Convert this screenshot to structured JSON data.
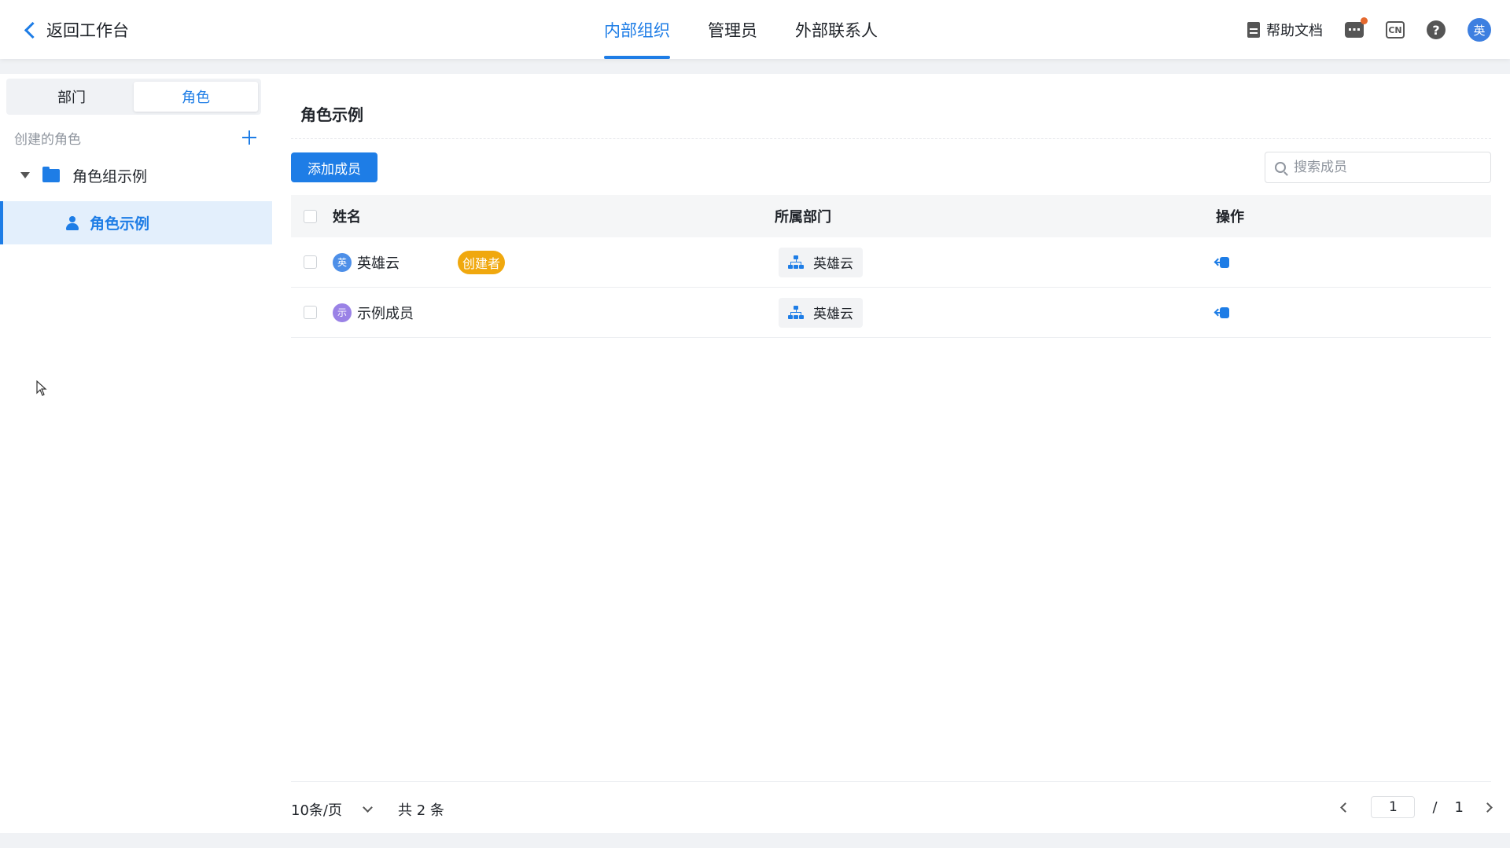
{
  "header": {
    "back_label": "返回工作台",
    "tabs": [
      {
        "label": "内部组织",
        "active": true
      },
      {
        "label": "管理员",
        "active": false
      },
      {
        "label": "外部联系人",
        "active": false
      }
    ],
    "help_label": "帮助文档",
    "lang_label": "CN",
    "question_label": "?",
    "avatar_label": "英"
  },
  "sidebar": {
    "segments": [
      {
        "label": "部门",
        "active": false
      },
      {
        "label": "角色",
        "active": true
      }
    ],
    "created_label": "创建的角色",
    "group_label": "角色组示例",
    "role_label": "角色示例"
  },
  "main": {
    "title": "角色示例",
    "add_button": "添加成员",
    "search_placeholder": "搜索成员",
    "columns": {
      "name": "姓名",
      "dept": "所属部门",
      "action": "操作"
    },
    "rows": [
      {
        "avatar": "英",
        "avatar_color": "#4d8fe8",
        "name": "英雄云",
        "badge": "创建者",
        "dept": "英雄云"
      },
      {
        "avatar": "示",
        "avatar_color": "#9a82e6",
        "name": "示例成员",
        "badge": "",
        "dept": "英雄云"
      }
    ]
  },
  "footer": {
    "page_size": "10条/页",
    "total": "共 2 条",
    "current_page": "1",
    "separator": "/",
    "total_pages": "1"
  },
  "colors": {
    "accent": "#1e7de6",
    "badge": "#f0a80e"
  }
}
